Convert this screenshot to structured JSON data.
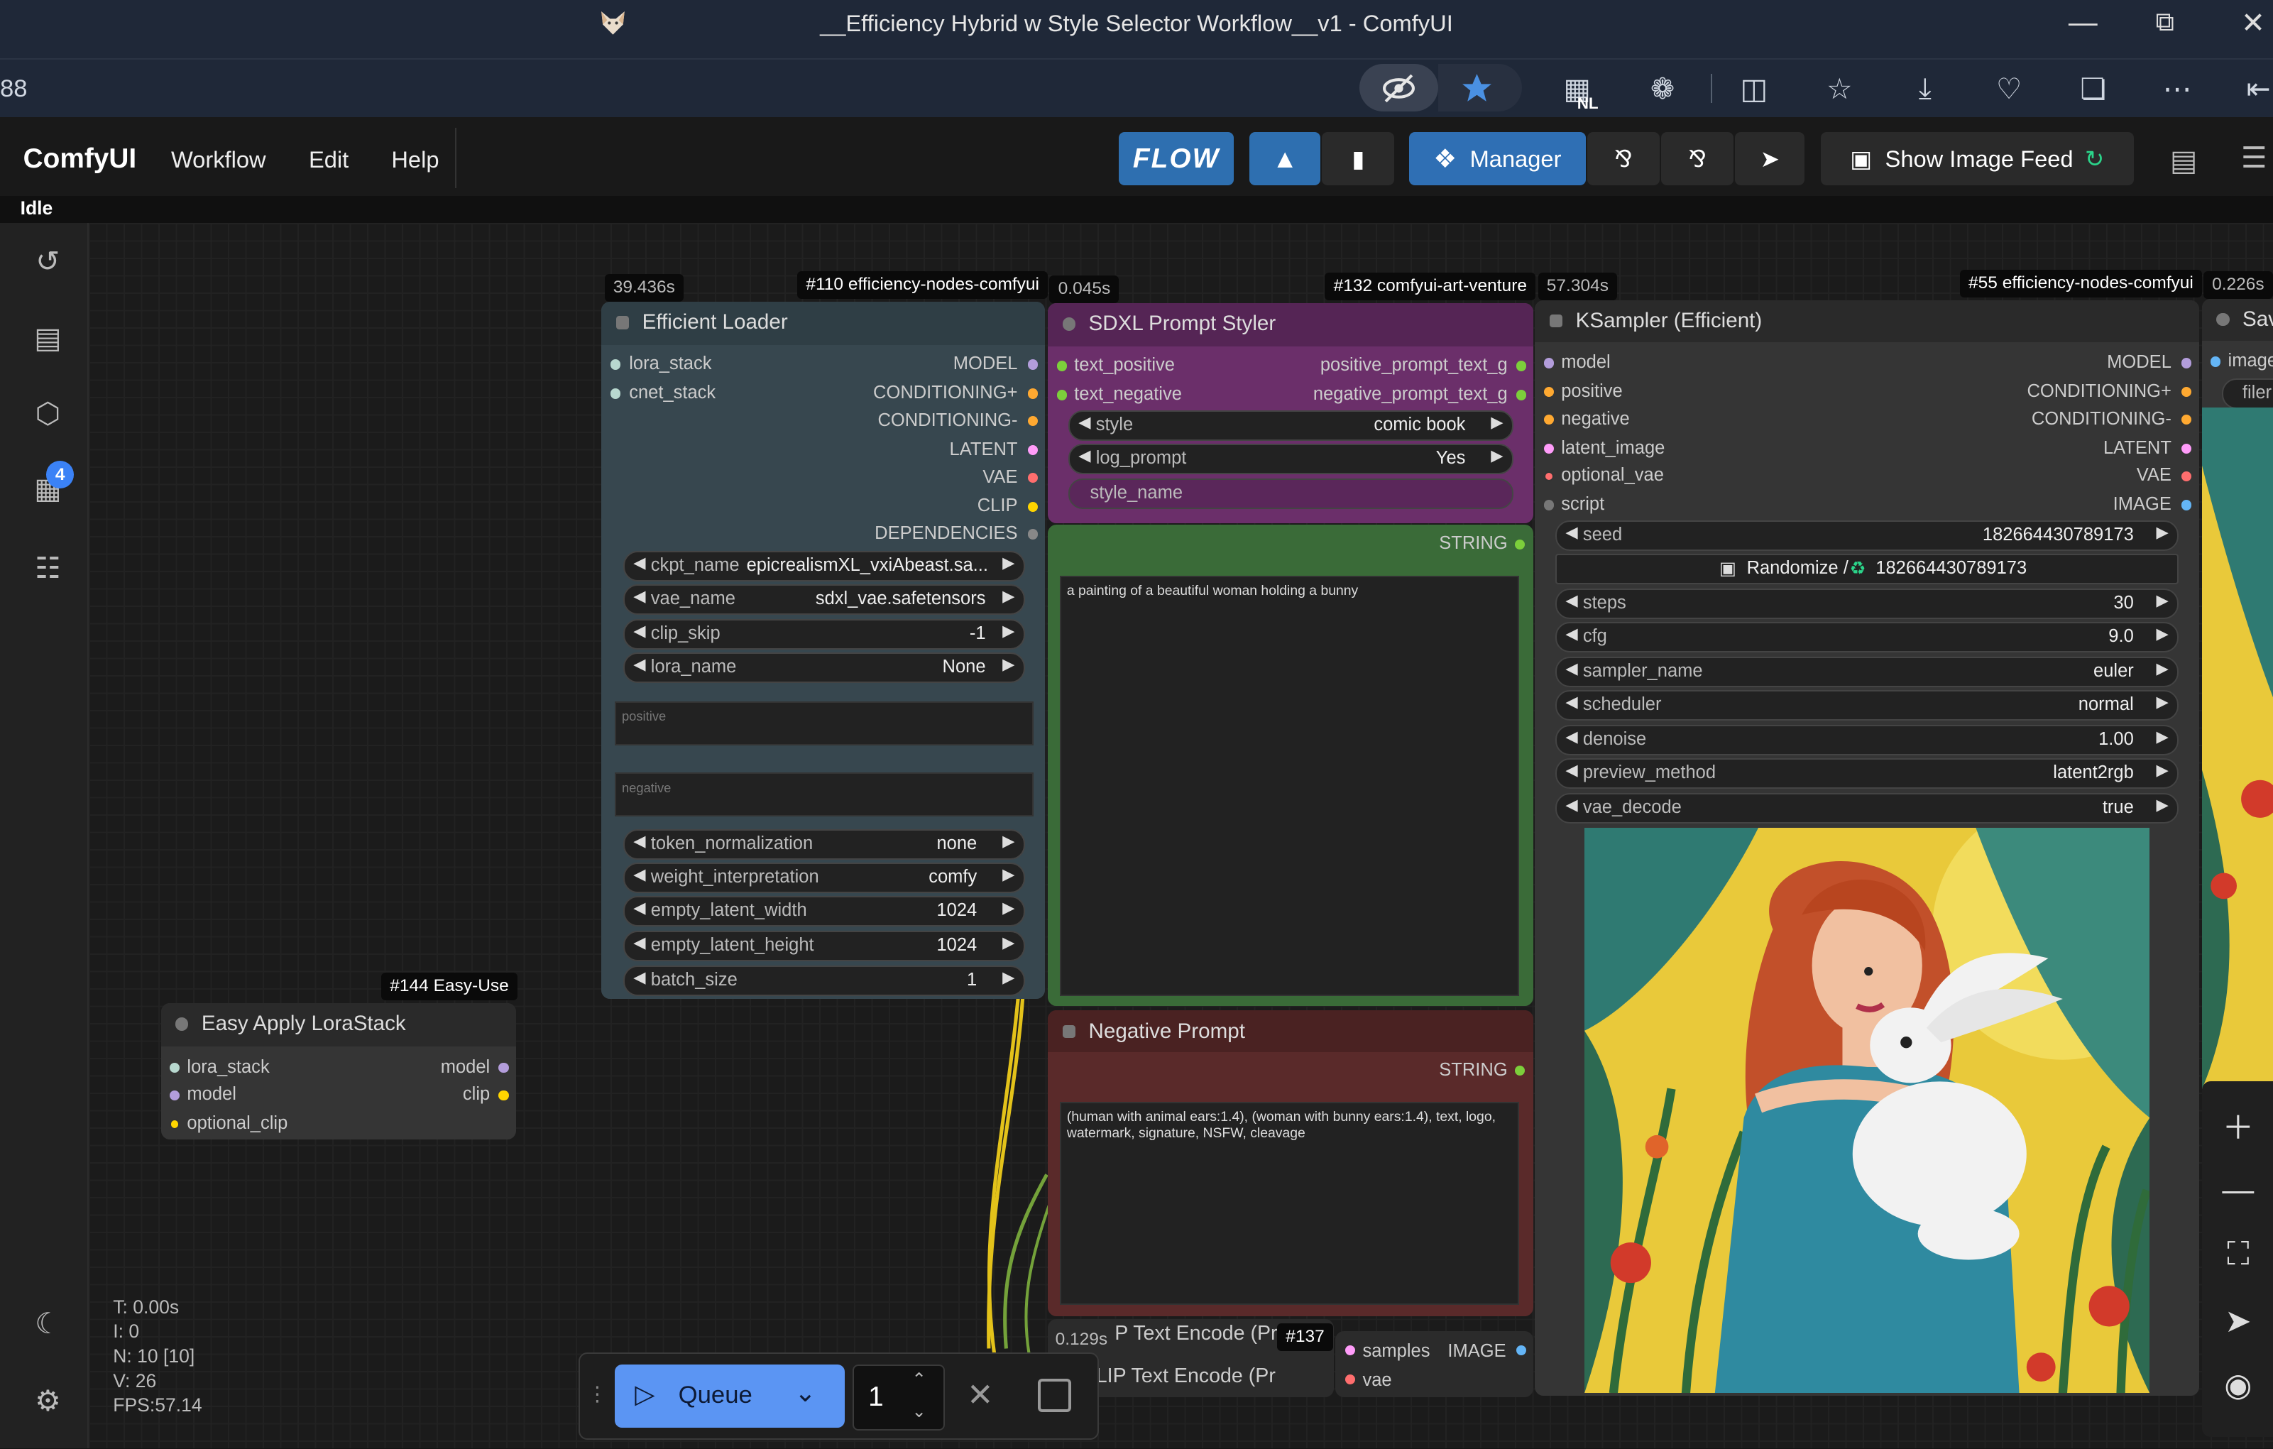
{
  "window": {
    "title": "__Efficiency Hybrid w Style Selector Workflow__v1 - ComfyUI",
    "address_partial": "88",
    "nl_badge": "NL"
  },
  "menu": {
    "brand": "ComfyUI",
    "items": [
      "Workflow",
      "Edit",
      "Help"
    ],
    "flow_label": "FLOW",
    "manager_label": "Manager",
    "show_image_feed_label": "Show Image Feed",
    "status": "Idle"
  },
  "sidebar": {
    "queue_badge": "4",
    "icons": [
      "history-icon",
      "document-icon",
      "cube-icon",
      "images-icon",
      "workflow-icon",
      "moon-icon",
      "settings-icon"
    ]
  },
  "nodes": {
    "efficient_loader": {
      "id_tag": "#110 efficiency-nodes-comfyui",
      "time": "39.436s",
      "title": "Efficient Loader",
      "inputs": [
        "lora_stack",
        "cnet_stack"
      ],
      "outputs": [
        "MODEL",
        "CONDITIONING+",
        "CONDITIONING-",
        "LATENT",
        "VAE",
        "CLIP",
        "DEPENDENCIES"
      ],
      "widgets": [
        {
          "name": "ckpt_name",
          "value": "epicrealismXL_vxiAbeast.sa..."
        },
        {
          "name": "vae_name",
          "value": "sdxl_vae.safetensors"
        },
        {
          "name": "clip_skip",
          "value": "-1"
        },
        {
          "name": "lora_name",
          "value": "None"
        }
      ],
      "positive_placeholder": "positive",
      "negative_placeholder": "negative",
      "widgets2": [
        {
          "name": "token_normalization",
          "value": "none"
        },
        {
          "name": "weight_interpretation",
          "value": "comfy"
        },
        {
          "name": "empty_latent_width",
          "value": "1024"
        },
        {
          "name": "empty_latent_height",
          "value": "1024"
        },
        {
          "name": "batch_size",
          "value": "1"
        }
      ]
    },
    "sdxl_prompt_styler": {
      "id_tag": "#132 comfyui-art-venture",
      "time": "0.045s",
      "title": "SDXL Prompt Styler",
      "inputs": [
        "text_positive",
        "text_negative"
      ],
      "outputs": [
        "positive_prompt_text_g",
        "negative_prompt_text_g"
      ],
      "widgets": [
        {
          "name": "style",
          "value": "comic book"
        },
        {
          "name": "log_prompt",
          "value": "Yes"
        }
      ],
      "extra_input": "style_name"
    },
    "positive_text": {
      "output": "STRING",
      "text": "a painting of a beautiful woman holding a bunny"
    },
    "negative_prompt": {
      "title": "Negative Prompt",
      "output": "STRING",
      "text": "(human with animal ears:1.4), (woman with bunny ears:1.4), text, logo, watermark, signature, NSFW, cleavage"
    },
    "clip_text_encode": {
      "time": "0.129s",
      "title_a": "P Text Encode (Pr",
      "title_b": "LIP Text Encode (Pr",
      "id_tag": "#137"
    },
    "vae_decode": {
      "inputs": [
        "samples",
        "vae"
      ],
      "output": "IMAGE"
    },
    "ksampler": {
      "id_tag": "#55 efficiency-nodes-comfyui",
      "time": "57.304s",
      "title": "KSampler (Efficient)",
      "inputs": [
        "model",
        "positive",
        "negative",
        "latent_image",
        "optional_vae",
        "script"
      ],
      "outputs": [
        "MODEL",
        "CONDITIONING+",
        "CONDITIONING-",
        "LATENT",
        "VAE",
        "IMAGE"
      ],
      "seed": {
        "name": "seed",
        "value": "182664430789173"
      },
      "randomize": "Randomize /",
      "randomize_value": "182664430789173",
      "widgets": [
        {
          "name": "steps",
          "value": "30"
        },
        {
          "name": "cfg",
          "value": "9.0"
        },
        {
          "name": "sampler_name",
          "value": "euler"
        },
        {
          "name": "scheduler",
          "value": "normal"
        },
        {
          "name": "denoise",
          "value": "1.00"
        },
        {
          "name": "preview_method",
          "value": "latent2rgb"
        },
        {
          "name": "vae_decode",
          "value": "true"
        }
      ]
    },
    "save_node": {
      "time": "0.226s",
      "title_partial": "Sav",
      "input": "image",
      "widget_partial": "filer"
    },
    "easy_lora": {
      "id_tag": "#144 Easy-Use",
      "title": "Easy Apply LoraStack",
      "inputs": [
        "lora_stack",
        "model",
        "optional_clip"
      ],
      "outputs": [
        "model",
        "clip"
      ]
    }
  },
  "stats": {
    "t": "T: 0.00s",
    "i": "I: 0",
    "n": "N: 10 [10]",
    "v": "V: 26",
    "fps": "FPS:57.14"
  },
  "queue": {
    "label": "Queue",
    "count": "1"
  },
  "colors": {
    "accent": "#5b95f3",
    "manager": "#2f6fb4",
    "styler": "#6b2f6a",
    "negative": "#5a2a2a",
    "green_node": "#3a6b38",
    "loader": "#37474f"
  }
}
